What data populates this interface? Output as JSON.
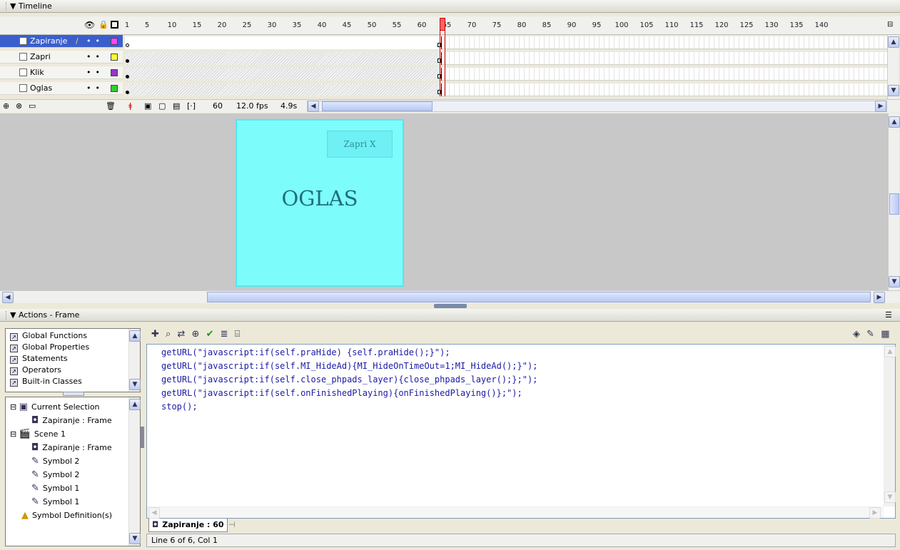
{
  "timeline": {
    "title": "Timeline",
    "ticks": [
      "1",
      "5",
      "10",
      "15",
      "20",
      "25",
      "30",
      "35",
      "40",
      "45",
      "50",
      "55",
      "60",
      "65",
      "70",
      "75",
      "80",
      "85",
      "90",
      "95",
      "100",
      "105",
      "110",
      "115",
      "120",
      "125",
      "130",
      "135",
      "140"
    ],
    "layers": [
      {
        "name": "Zapiranje",
        "selected": true,
        "color": "#ff44ff"
      },
      {
        "name": "Zapri",
        "selected": false,
        "color": "#ffff33"
      },
      {
        "name": "Klik",
        "selected": false,
        "color": "#9933cc"
      },
      {
        "name": "Oglas",
        "selected": false,
        "color": "#33cc33"
      }
    ],
    "current_frame": "60",
    "frame_rate": "12.0 fps",
    "elapsed": "4.9s"
  },
  "stage": {
    "close_button_label": "Zapri X",
    "ad_text": "OGLAS",
    "ad_color": "#7dfcfc"
  },
  "actions": {
    "title": "Actions - Frame",
    "toolbox": [
      "Global Functions",
      "Global Properties",
      "Statements",
      "Operators",
      "Built-in Classes"
    ],
    "tree": {
      "current_selection": "Current Selection",
      "current_frame": "Zapiranje : Frame",
      "scene": "Scene 1",
      "scene_frame": "Zapiranje : Frame",
      "symbols": [
        "Symbol 2",
        "Symbol 2",
        "Symbol 1",
        "Symbol 1"
      ],
      "definitions": "Symbol Definition(s)"
    },
    "code": [
      "getURL(\"javascript:if(self.praHide) {self.praHide();}\");",
      "getURL(\"javascript:if(self.MI_HideAd){MI_HideOnTimeOut=1;MI_HideAd();}\");",
      "getURL(\"javascript:if(self.close_phpads_layer){close_phpads_layer();};\");",
      "getURL(\"javascript:if(self.onFinishedPlaying){onFinishedPlaying()};\");",
      "stop();"
    ],
    "tab_label": "Zapiranje : 60",
    "status": "Line 6 of 6, Col 1"
  }
}
